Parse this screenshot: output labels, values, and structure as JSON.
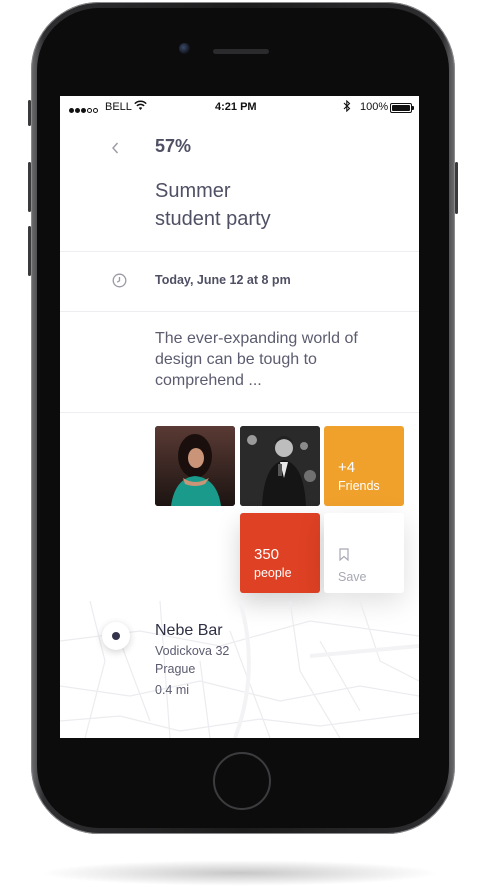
{
  "status_bar": {
    "carrier": "BELL",
    "time": "4:21 PM",
    "battery": "100%"
  },
  "event": {
    "progress": "57%",
    "title_line1": "Summer",
    "title_line2": "student party",
    "datetime": "Today, June 12 at 8 pm",
    "description": "The ever-expanding world of design can be tough to comprehend ...",
    "friends_count": "+4",
    "friends_label": "Friends",
    "people_count": "350",
    "people_label": "people",
    "save_label": "Save"
  },
  "location": {
    "name": "Nebe Bar",
    "street": "Vodickova 32",
    "city": "Prague",
    "distance": "0.4 mi"
  },
  "colors": {
    "friends_tile": "#f0a12c",
    "people_tile": "#df4124",
    "text_primary": "#4f5064"
  },
  "icons": {
    "back": "chevron-left-icon",
    "clock": "clock-icon",
    "save": "bookmark-icon",
    "pin": "location-pin-icon"
  }
}
